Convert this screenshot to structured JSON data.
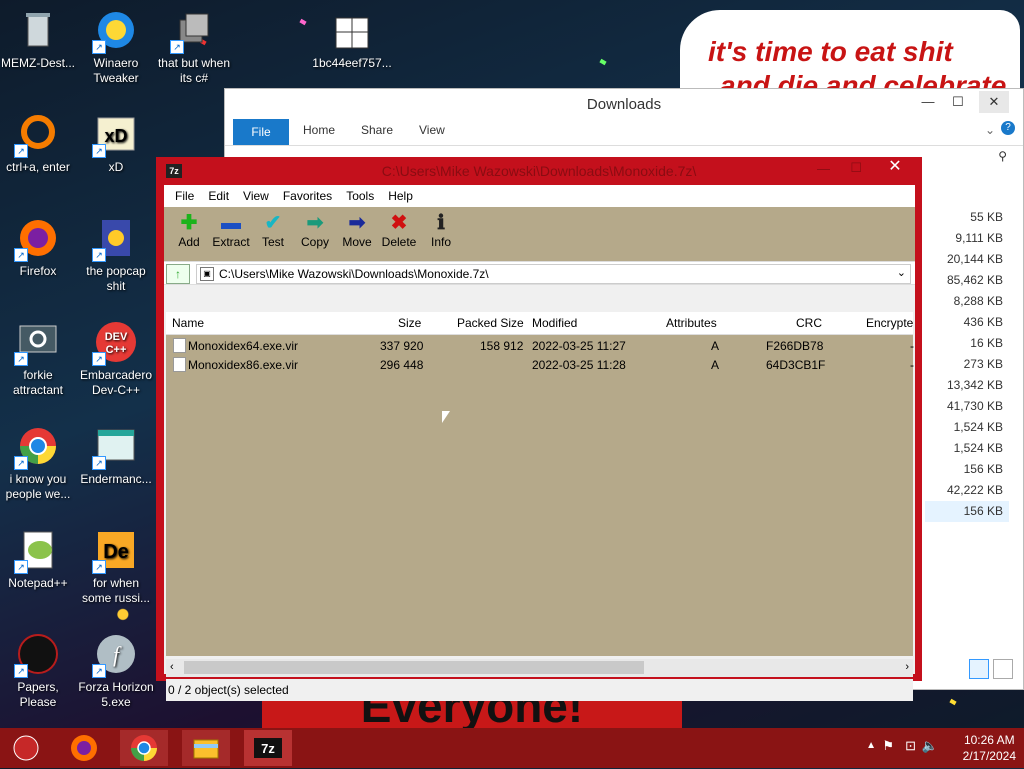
{
  "desktop": {
    "icons": [
      {
        "label": "MEMZ-Dest..."
      },
      {
        "label": "Winaero Tweaker"
      },
      {
        "label": "that but when its c#"
      },
      {
        "label": "1bc44eef757..."
      },
      {
        "label": "ctrl+a, enter"
      },
      {
        "label": "xD"
      },
      {
        "label": "Firefox"
      },
      {
        "label": "the popcap shit"
      },
      {
        "label": "forkie attractant"
      },
      {
        "label": "Embarcadero Dev-C++"
      },
      {
        "label": "i know you people we..."
      },
      {
        "label": "Endermanc..."
      },
      {
        "label": "Notepad++"
      },
      {
        "label": "for when some russi..."
      },
      {
        "label": "Papers, Please"
      },
      {
        "label": "Forza Horizon 5.exe"
      }
    ],
    "banner_line1": "it's time to eat shit",
    "banner_line2": "and die and celebrate",
    "bottom_banner": "Everyone!"
  },
  "explorer": {
    "title": "Downloads",
    "tabs": [
      "File",
      "Home",
      "Share",
      "View"
    ],
    "sizes": [
      "55 KB",
      "9,111 KB",
      "20,144 KB",
      "85,462 KB",
      "8,288 KB",
      "436 KB",
      "16 KB",
      "273 KB",
      "13,342 KB",
      "41,730 KB",
      "1,524 KB",
      "1,524 KB",
      "156 KB",
      "42,222 KB",
      "156 KB"
    ]
  },
  "sevenzip": {
    "title": "C:\\Users\\Mike Wazowski\\Downloads\\Monoxide.7z\\",
    "menu": [
      "File",
      "Edit",
      "View",
      "Favorites",
      "Tools",
      "Help"
    ],
    "toolbar": [
      {
        "label": "Add",
        "glyph": "✚",
        "color": "#1bb31b"
      },
      {
        "label": "Extract",
        "glyph": "▬",
        "color": "#1a4fc4"
      },
      {
        "label": "Test",
        "glyph": "✔",
        "color": "#18b6c4"
      },
      {
        "label": "Copy",
        "glyph": "➡",
        "color": "#1b9a7b"
      },
      {
        "label": "Move",
        "glyph": "➡",
        "color": "#1a2a9a"
      },
      {
        "label": "Delete",
        "glyph": "✖",
        "color": "#d01010"
      },
      {
        "label": "Info",
        "glyph": "ℹ",
        "color": "#222"
      }
    ],
    "address": "C:\\Users\\Mike Wazowski\\Downloads\\Monoxide.7z\\",
    "columns": [
      "Name",
      "Size",
      "Packed Size",
      "Modified",
      "Attributes",
      "CRC",
      "Encrypte"
    ],
    "rows": [
      {
        "name": "Monoxidex64.exe.vir",
        "size": "337 920",
        "packed": "158 912",
        "modified": "2022-03-25 11:27",
        "attr": "A",
        "crc": "F266DB78",
        "enc": "-"
      },
      {
        "name": "Monoxidex86.exe.vir",
        "size": "296 448",
        "packed": "",
        "modified": "2022-03-25 11:28",
        "attr": "A",
        "crc": "64D3CB1F",
        "enc": "-"
      }
    ],
    "status": "0 / 2 object(s) selected"
  },
  "taskbar": {
    "time": "10:26 AM",
    "date": "2/17/2024"
  }
}
